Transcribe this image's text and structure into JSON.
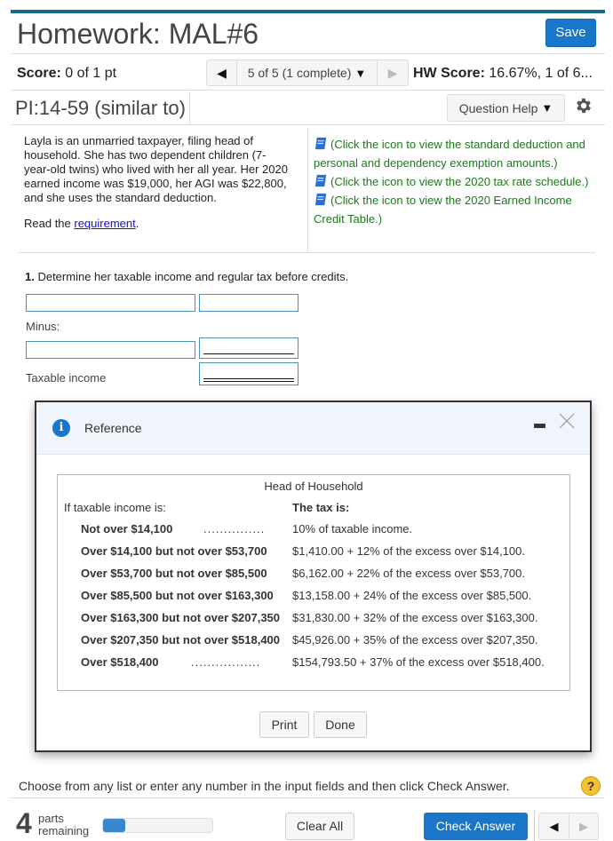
{
  "header": {
    "title": "Homework: MAL#6",
    "save_label": "Save"
  },
  "scorebar": {
    "score_label": "Score:",
    "score_value": "0 of 1 pt",
    "nav_prev": "◀",
    "nav_position": "5 of 5 (1 complete)",
    "nav_caret": "▼",
    "nav_next": "▶",
    "hw_score_label": "HW Score:",
    "hw_score_value": "16.67%, 1 of 6..."
  },
  "question": {
    "id": "PI:14-59 (similar to)",
    "help_label": "Question Help",
    "help_caret": "▼"
  },
  "problem": {
    "text": "Layla is an unmarried taxpayer, filing head of household. She has two dependent children (7-year-old twins) who lived with her all year. Her 2020 earned income was $19,000, her AGI was $22,800, and she uses the standard deduction.",
    "read_prefix": "Read the ",
    "read_link": "requirement",
    "read_suffix": "."
  },
  "resources": [
    {
      "icon": "book-icon",
      "text": "(Click the icon to view the standard deduction and personal and dependency exemption amounts.)"
    },
    {
      "icon": "book-icon",
      "text": "(Click the icon to view the 2020 tax rate schedule.)"
    },
    {
      "icon": "book-icon",
      "text": "(Click the icon to view the 2020 Earned Income Credit Table.)"
    }
  ],
  "step": {
    "number": "1.",
    "text": " Determine her taxable income and regular tax before credits.",
    "minus_label": "Minus:",
    "taxable_income_label": "Taxable income",
    "inputs": {
      "row1_label": "",
      "row1_value": "",
      "row2_label": "",
      "row2_value": "",
      "taxable_income_value": ""
    }
  },
  "modal": {
    "title": "Reference",
    "table_caption": "Head of Household",
    "left_header": "If taxable income is:",
    "right_header": "The tax is:",
    "rows": [
      {
        "condition": "Not over $14,100",
        "dots": "...............",
        "tax": "10% of taxable income."
      },
      {
        "condition": "Over $14,100 but not over $53,700",
        "dots": "",
        "tax": "$1,410.00 + 12% of the excess over $14,100."
      },
      {
        "condition": "Over $53,700 but not over $85,500",
        "dots": "",
        "tax": "$6,162.00 + 22% of the excess over $53,700."
      },
      {
        "condition": "Over $85,500 but not over $163,300",
        "dots": "",
        "tax": "$13,158.00 + 24% of the excess over $85,500."
      },
      {
        "condition": "Over $163,300 but not over $207,350",
        "dots": "",
        "tax": "$31,830.00 + 32% of the excess over $163,300."
      },
      {
        "condition": "Over $207,350 but not over $518,400",
        "dots": "",
        "tax": "$45,926.00 + 35% of the excess over $207,350."
      },
      {
        "condition": "Over $518,400",
        "dots": ".................",
        "tax": "$154,793.50 + 37% of the excess over $518,400."
      }
    ],
    "print_label": "Print",
    "done_label": "Done"
  },
  "footer": {
    "instruction": "Choose from any list or enter any number in the input fields and then click Check Answer.",
    "help_icon": "?",
    "parts_number": "4",
    "parts_label_1": "parts",
    "parts_label_2": "remaining",
    "progress_fraction": 0.2,
    "clear_all_label": "Clear All",
    "check_answer_label": "Check Answer",
    "nav_prev": "◀",
    "nav_next": "▶"
  },
  "colors": {
    "accent": "#1a76c8",
    "topbar": "#1a6b8a",
    "resource_link": "#1a7a1a",
    "help_badge": "#f2c230"
  }
}
